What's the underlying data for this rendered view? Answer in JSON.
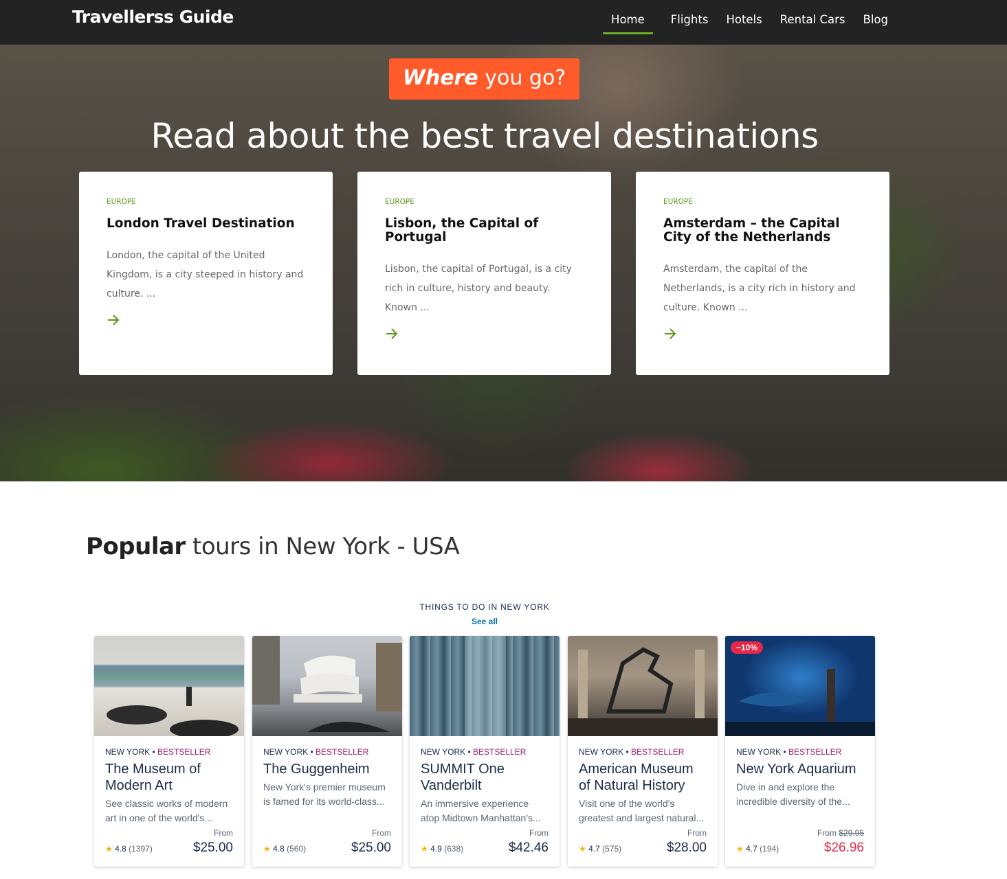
{
  "header": {
    "logo": "Travellerss Guide",
    "nav": [
      "Home",
      "Flights",
      "Hotels",
      "Rental Cars",
      "Blog"
    ],
    "active": "Home"
  },
  "hero": {
    "badge_bold": "Where",
    "badge_rest": "you go?",
    "title": "Read about the best travel destinations",
    "cards": [
      {
        "region": "EUROPE",
        "title": "London Travel Destination",
        "text": "London, the capital of the United Kingdom, is a city steeped in history and culture. ..."
      },
      {
        "region": "EUROPE",
        "title": "Lisbon, the Capital of Portugal",
        "text": "Lisbon, the capital of Portugal, is a city rich in culture, history and beauty. Known ..."
      },
      {
        "region": "EUROPE",
        "title": "Amsterdam – the Capital City of the Netherlands",
        "text": "Amsterdam, the capital of the Netherlands, is a city rich in history and culture. Known ..."
      }
    ]
  },
  "popular": {
    "title_bold": "Popular",
    "title_rest": "tours in New York - USA",
    "things": "THINGS TO DO IN NEW YORK",
    "see_all": "See all",
    "tours": [
      {
        "city": "NEW YORK",
        "tag": "BESTSELLER",
        "name": "The Museum of Modern Art",
        "desc": "See classic works of modern art in one of the world's...",
        "rating": "4.8",
        "count": "(1397)",
        "from": "From",
        "old_price": "",
        "price": "$25.00",
        "discount": ""
      },
      {
        "city": "NEW YORK",
        "tag": "BESTSELLER",
        "name": "The Guggenheim",
        "desc": "New York's premier museum is famed for its world-class...",
        "rating": "4.8",
        "count": "(560)",
        "from": "From",
        "old_price": "",
        "price": "$25.00",
        "discount": ""
      },
      {
        "city": "NEW YORK",
        "tag": "BESTSELLER",
        "name": "SUMMIT One Vanderbilt",
        "desc": "An immersive experience atop Midtown Manhattan's...",
        "rating": "4.9",
        "count": "(638)",
        "from": "From",
        "old_price": "",
        "price": "$42.46",
        "discount": ""
      },
      {
        "city": "NEW YORK",
        "tag": "BESTSELLER",
        "name": "American Museum of Natural History",
        "desc": "Visit one of the world's greatest and largest natural...",
        "rating": "4.7",
        "count": "(575)",
        "from": "From",
        "old_price": "",
        "price": "$28.00",
        "discount": ""
      },
      {
        "city": "NEW YORK",
        "tag": "BESTSELLER",
        "name": "New York Aquarium",
        "desc": "Dive in and explore the incredible diversity of the...",
        "rating": "4.7",
        "count": "(194)",
        "from": "From",
        "old_price": "$29.95",
        "price": "$26.96",
        "discount": "−10%"
      }
    ]
  },
  "colors": {
    "accent_green": "#6ab023",
    "badge_orange": "#ff5a29",
    "sale_red": "#e8284b"
  }
}
